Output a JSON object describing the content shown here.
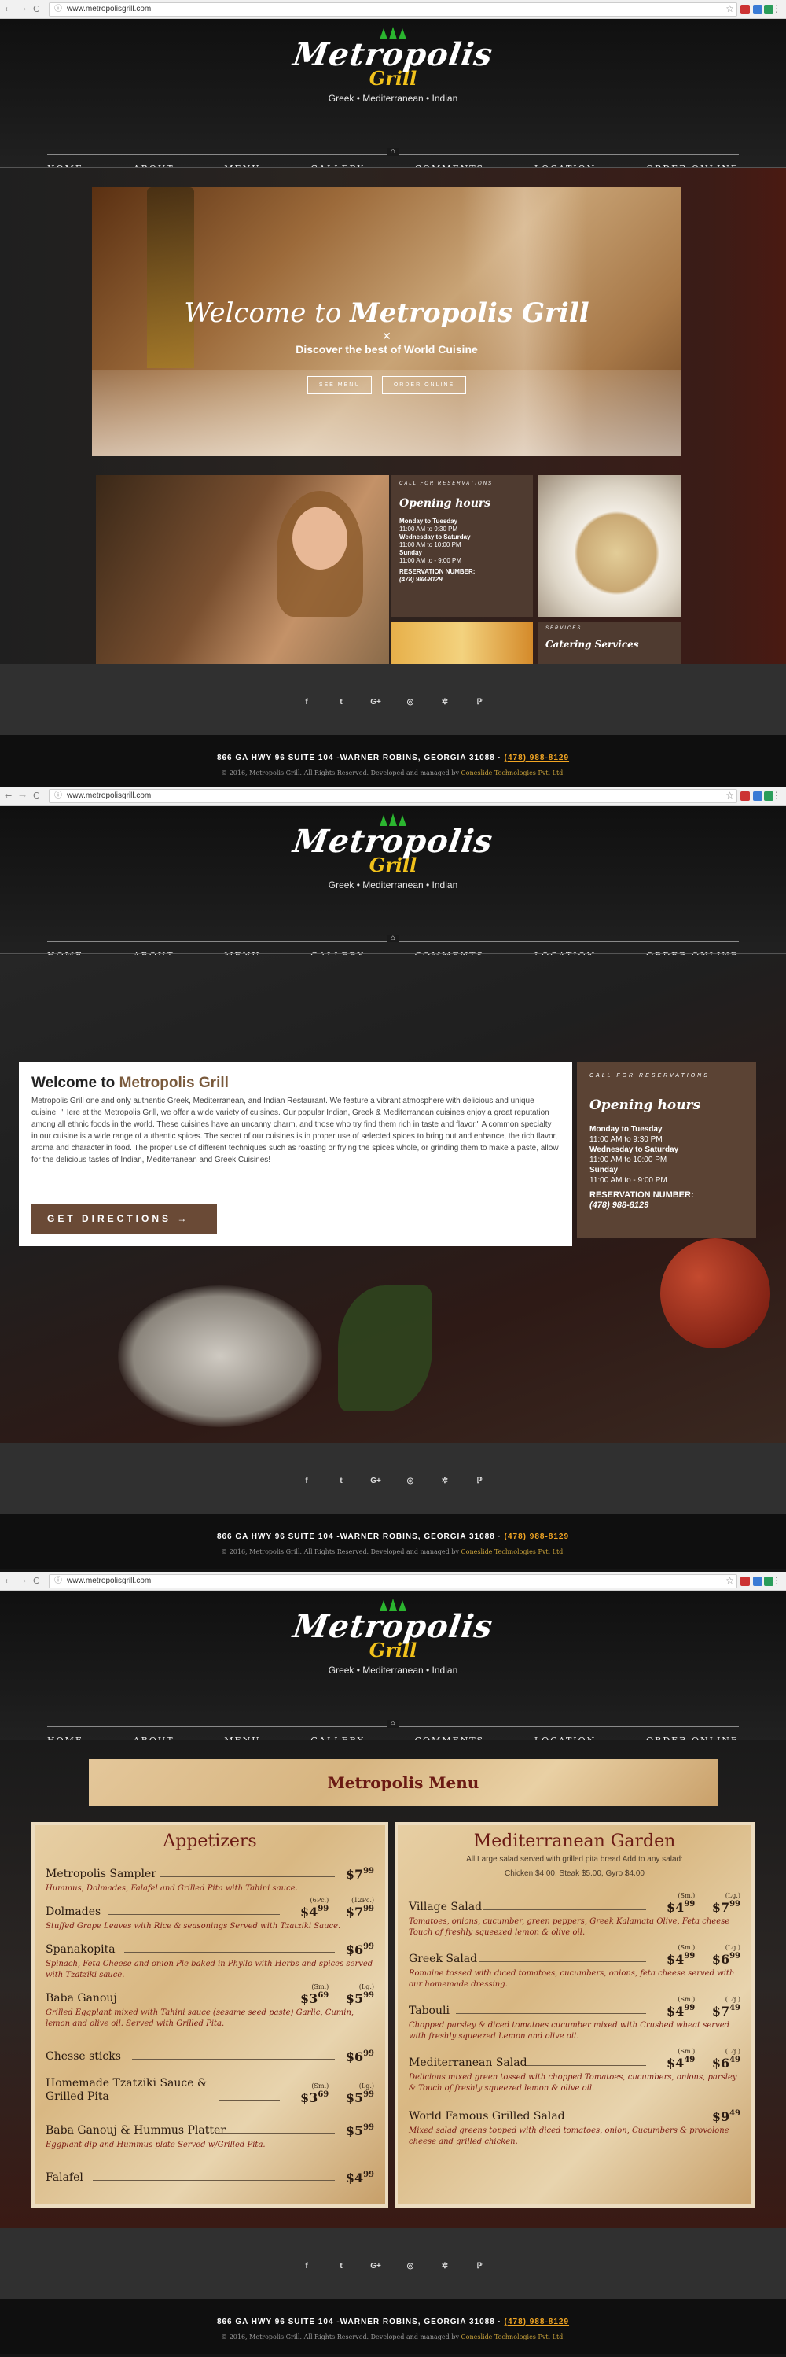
{
  "browser": {
    "url": "www.metropolisgrill.com",
    "back": "←",
    "forward": "→",
    "reload": "C",
    "lock": "ⓘ",
    "star": "☆",
    "menu": "⋮"
  },
  "brand": {
    "name": "Metropolis",
    "sub": "Grill",
    "tagline": "Greek • Mediterranean • Indian"
  },
  "nav": [
    "HOME",
    "ABOUT",
    "MENU",
    "GALLERY",
    "COMMENTS",
    "LOCATION",
    "ORDER ONLINE"
  ],
  "hero": {
    "title_pre": "Welcome to ",
    "title_bold": "Metropolis Grill",
    "x": "✕",
    "subtitle": "Discover the best of World Cuisine",
    "btn1": "SEE MENU",
    "btn2": "ORDER ONLINE"
  },
  "hours": {
    "call": "CALL FOR RESERVATIONS",
    "title": "Opening hours",
    "l1": "Monday to Tuesday",
    "l2": "11:00 AM to 9:30 PM",
    "l3": "Wednesday to Saturday",
    "l4": "11:00 AM to 10:00 PM",
    "l5": "Sunday",
    "l6": "11:00 AM to - 9:00 PM",
    "r1": "RESERVATION NUMBER:",
    "r2": "(478) 988-8129"
  },
  "services": {
    "label": "SERVICES",
    "title": "Catering Services"
  },
  "social": [
    "f",
    "t",
    "G+",
    "◎",
    "✲",
    "ℙ"
  ],
  "footer": {
    "address": "866 GA HWY 96 SUITE 104 -WARNER ROBINS, GEORGIA 31088 · ",
    "phone": "(478) 988-8129",
    "copy": "© 2016, Metropolis Grill. All Rights Reserved. Developed and managed by ",
    "company": "Coneslide Technologies Pvt. Ltd."
  },
  "about": {
    "title_pre": "Welcome to ",
    "title_hl": "Metropolis Grill",
    "body": "Metropolis Grill one and only authentic Greek, Mediterranean, and Indian Restaurant. We feature a vibrant atmosphere with delicious and unique cuisine. \"Here at the Metropolis Grill, we offer a wide variety of cuisines. Our popular Indian, Greek & Mediterranean cuisines enjoy a great reputation among all ethnic foods in the world. These cuisines have an uncanny charm, and those who try find them rich in taste and flavor.\" A common specialty in our cuisine is a wide range of authentic spices. The secret of our cuisines is in proper use of selected spices to bring out and enhance, the rich flavor, aroma and character in food. The proper use of different techniques such as roasting or frying the spices whole, or grinding them to make a paste, allow for the delicious tastes of Indian, Mediterranean and Greek Cuisines!",
    "button": "GET DIRECTIONS →"
  },
  "menu": {
    "title": "Metropolis Menu",
    "appetizers": {
      "title": "Appetizers",
      "items": [
        {
          "name": "Metropolis Sampler",
          "price": "$7",
          "cents": "99",
          "desc": "Hummus, Dolmades, Falafel and Grilled Pita with Tahini sauce."
        },
        {
          "name": "Dolmades",
          "sm_label": "(6Pc.)",
          "sm": "$4",
          "sm_c": "99",
          "lg_label": "(12Pc.)",
          "lg": "$7",
          "lg_c": "99",
          "desc": "Stuffed Grape Leaves with Rice & seasonings Served with Tzatziki Sauce."
        },
        {
          "name": "Spanakopita",
          "price": "$6",
          "cents": "99",
          "desc": "Spinach, Feta Cheese and onion Pie baked in Phyllo with Herbs and spices served with Tzatziki sauce."
        },
        {
          "name": "Baba Ganouj",
          "sm_label": "(Sm.)",
          "sm": "$3",
          "sm_c": "69",
          "lg_label": "(Lg.)",
          "lg": "$5",
          "lg_c": "99",
          "desc": "Grilled Eggplant mixed with Tahini sauce (sesame seed paste) Garlic, Cumin, lemon and olive oil. Served with Grilled Pita."
        },
        {
          "name": "Chesse sticks",
          "price": "$6",
          "cents": "99",
          "desc": ""
        },
        {
          "name": "Homemade Tzatziki Sauce & Grilled Pita",
          "sm_label": "(Sm.)",
          "sm": "$3",
          "sm_c": "69",
          "lg_label": "(Lg.)",
          "lg": "$5",
          "lg_c": "99",
          "desc": ""
        },
        {
          "name": "Baba Ganouj & Hummus Platter",
          "price": "$5",
          "cents": "99",
          "desc": "Eggplant dip and Hummus plate Served w/Grilled Pita."
        },
        {
          "name": "Falafel",
          "price": "$4",
          "cents": "99",
          "desc": ""
        }
      ]
    },
    "garden": {
      "title": "Mediterranean Garden",
      "note1": "All Large salad served with grilled pita bread Add to any salad:",
      "note2": "Chicken $4.00, Steak $5.00, Gyro $4.00",
      "items": [
        {
          "name": "Village Salad",
          "sm_label": "(Sm.)",
          "sm": "$4",
          "sm_c": "99",
          "lg_label": "(Lg.)",
          "lg": "$7",
          "lg_c": "99",
          "desc": "Tomatoes, onions, cucumber, green peppers, Greek Kalamata Olive, Feta cheese Touch of freshly squeezed lemon & olive oil."
        },
        {
          "name": "Greek Salad",
          "sm_label": "(Sm.)",
          "sm": "$4",
          "sm_c": "99",
          "lg_label": "(Lg.)",
          "lg": "$6",
          "lg_c": "99",
          "desc": "Romaine tossed with diced tomatoes, cucumbers, onions, feta cheese served with our homemade dressing."
        },
        {
          "name": "Tabouli",
          "sm_label": "(Sm.)",
          "sm": "$4",
          "sm_c": "99",
          "lg_label": "(Lg.)",
          "lg": "$7",
          "lg_c": "49",
          "desc": "Chopped parsley & diced tomatoes cucumber mixed with Crushed wheat served with freshly squeezed Lemon and olive oil."
        },
        {
          "name": "Mediterranean Salad",
          "sm_label": "(Sm.)",
          "sm": "$4",
          "sm_c": "49",
          "lg_label": "(Lg.)",
          "lg": "$6",
          "lg_c": "49",
          "desc": "Delicious mixed green tossed with chopped Tomatoes, cucumbers, onions, parsley & Touch of freshly squeezed lemon & olive oil."
        },
        {
          "name": "World Famous Grilled Salad",
          "price": "$9",
          "cents": "49",
          "desc": "Mixed salad greens topped with diced tomatoes, onion, Cucumbers & provolone cheese and grilled chicken."
        }
      ]
    }
  }
}
